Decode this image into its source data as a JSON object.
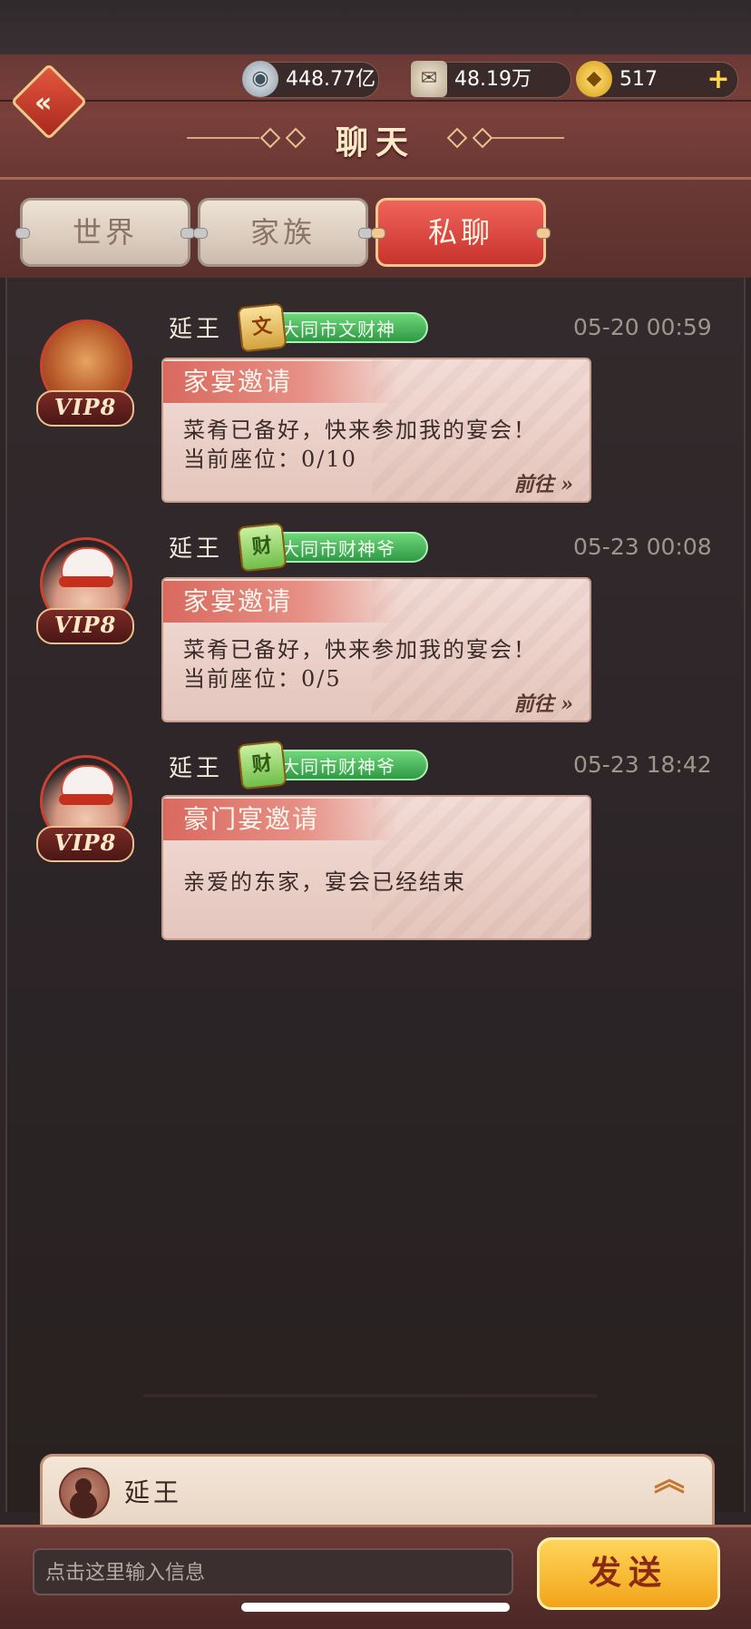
{
  "header": {
    "title": "聊天",
    "resources": [
      {
        "icon": "silver-coin-icon",
        "value": "448.77亿"
      },
      {
        "icon": "scroll-icon",
        "value": "48.19万"
      },
      {
        "icon": "gold-ingot-icon",
        "value": "517"
      }
    ]
  },
  "tabs": [
    {
      "label": "世界",
      "active": false
    },
    {
      "label": "家族",
      "active": false
    },
    {
      "label": "私聊",
      "active": true
    }
  ],
  "messages": [
    {
      "sender": "延王",
      "vip": "VIP8",
      "badge_emblem": "文",
      "badge_title": "大同市文财神",
      "time": "05-20 00:59",
      "card_title": "家宴邀请",
      "lines": [
        "菜肴已备好，快来参加我的宴会！",
        "当前座位：0/10"
      ],
      "action": "前往"
    },
    {
      "sender": "延王",
      "vip": "VIP8",
      "badge_emblem": "财",
      "badge_title": "大同市财神爷",
      "time": "05-23 00:08",
      "card_title": "家宴邀请",
      "lines": [
        "菜肴已备好，快来参加我的宴会！",
        "当前座位：0/5"
      ],
      "action": "前往"
    },
    {
      "sender": "延王",
      "vip": "VIP8",
      "badge_emblem": "财",
      "badge_title": "大同市财神爷",
      "time": "05-23 18:42",
      "card_title": "豪门宴邀请",
      "lines": [
        "亲爱的东家，宴会已经结束"
      ]
    }
  ],
  "recipient": {
    "name": "延王"
  },
  "composer": {
    "placeholder": "点击这里输入信息",
    "send_label": "发送"
  }
}
